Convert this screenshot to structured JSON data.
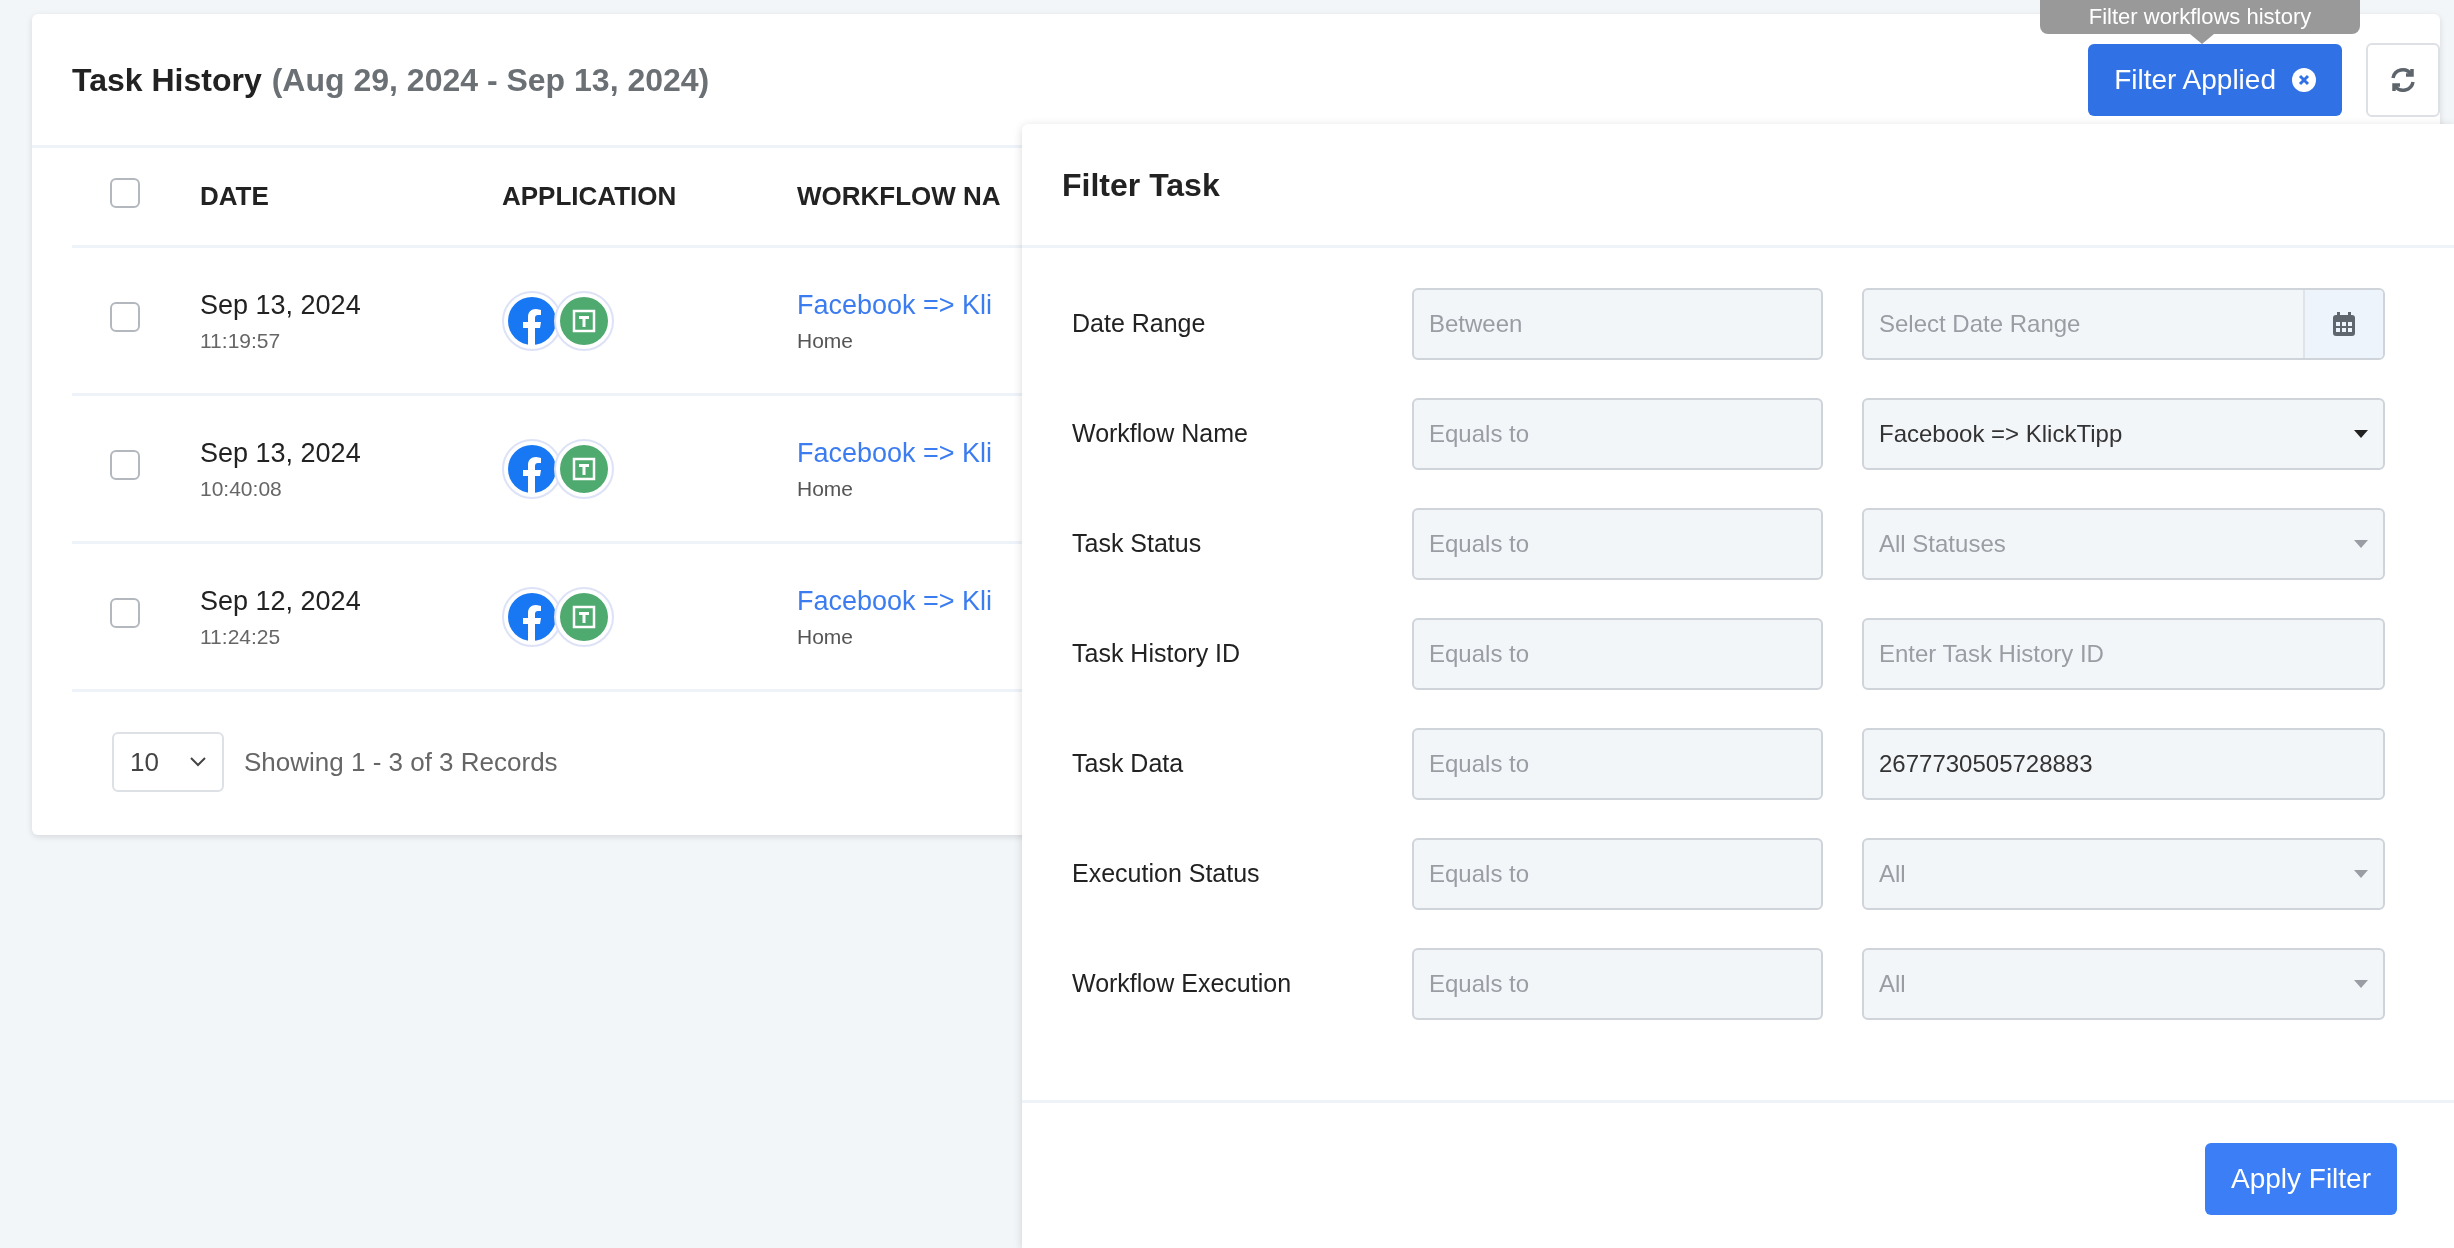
{
  "header": {
    "title": "Task History",
    "date_range": "(Aug 29, 2024 - Sep 13, 2024)",
    "filter_button": "Filter Applied",
    "tooltip": "Filter workflows history"
  },
  "table": {
    "select_all": {
      "checked": false
    },
    "columns": [
      "DATE",
      "APPLICATION",
      "WORKFLOW NA"
    ],
    "rows": [
      {
        "checked": false,
        "date": "Sep 13, 2024",
        "time": "11:19:57",
        "workflow": "Facebook => Kli",
        "folder": "Home"
      },
      {
        "checked": false,
        "date": "Sep 13, 2024",
        "time": "10:40:08",
        "workflow": "Facebook => Kli",
        "folder": "Home"
      },
      {
        "checked": false,
        "date": "Sep 12, 2024",
        "time": "11:24:25",
        "workflow": "Facebook => Kli",
        "folder": "Home"
      }
    ]
  },
  "pagination": {
    "page_size": "10",
    "summary": "Showing 1 - 3 of 3 Records"
  },
  "filter_panel": {
    "title": "Filter Task",
    "rows": [
      {
        "label": "Date Range",
        "operator": {
          "placeholder": "Between"
        },
        "value": {
          "kind": "date",
          "placeholder": "Select Date Range"
        }
      },
      {
        "label": "Workflow Name",
        "operator": {
          "placeholder": "Equals to"
        },
        "value": {
          "kind": "select",
          "value": "Facebook => KlickTipp"
        }
      },
      {
        "label": "Task Status",
        "operator": {
          "placeholder": "Equals to"
        },
        "value": {
          "kind": "select",
          "placeholder": "All Statuses"
        }
      },
      {
        "label": "Task History ID",
        "operator": {
          "placeholder": "Equals to"
        },
        "value": {
          "kind": "text",
          "placeholder": "Enter Task History ID"
        }
      },
      {
        "label": "Task Data",
        "operator": {
          "placeholder": "Equals to"
        },
        "value": {
          "kind": "text",
          "value": "2677730505728883"
        }
      },
      {
        "label": "Execution Status",
        "operator": {
          "placeholder": "Equals to"
        },
        "value": {
          "kind": "select",
          "placeholder": "All"
        }
      },
      {
        "label": "Workflow Execution",
        "operator": {
          "placeholder": "Equals to"
        },
        "value": {
          "kind": "select",
          "placeholder": "All"
        }
      }
    ],
    "apply_button": "Apply Filter"
  }
}
